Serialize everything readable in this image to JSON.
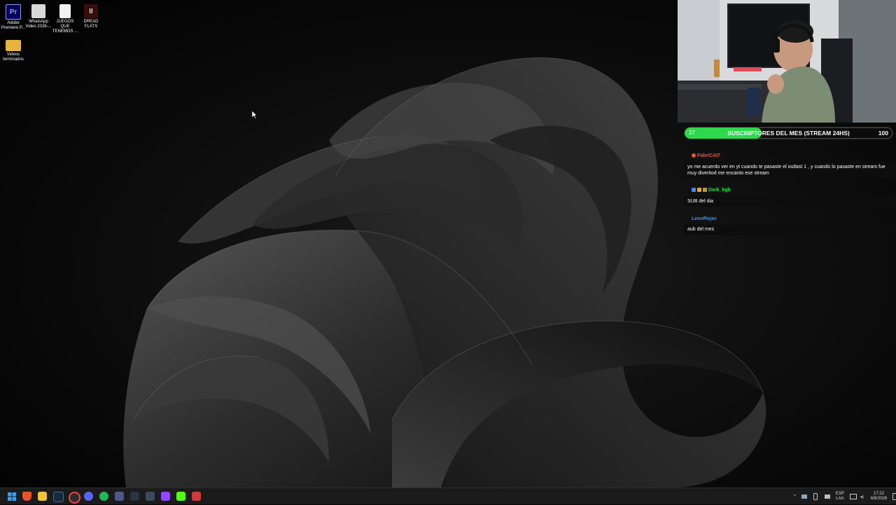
{
  "desktop": {
    "icons": [
      {
        "label": "Adobe Premiere P...",
        "glyph": "Pr"
      },
      {
        "label": "WhatsApp Video 2026-...",
        "glyph": ""
      },
      {
        "label": "JUEGOS QUE TENEMOS ...",
        "glyph": ""
      },
      {
        "label": "DREAD FLATS",
        "glyph": "II"
      },
      {
        "label": "Videos terminados",
        "glyph": ""
      }
    ]
  },
  "goal": {
    "current": "37",
    "title": "SUSCRIPTORES DEL MES (STREAM 24HS)",
    "target": "100",
    "progress": 0.37,
    "color": "#2bd94a"
  },
  "chat": [
    {
      "user": "FabriCAI7",
      "color": "#e0554f",
      "text": "yo me acuerdo ver en yt cuando te pasaste el outlast 1 , y cuando lo pasaste en stream fue muy diveritod me encanto ese stream"
    },
    {
      "user": "Dark_kgb",
      "color": "#2bd94a",
      "text": "SUB del dia"
    },
    {
      "user": "LeooRojas",
      "color": "#3a8ef0",
      "text": "aub del mes"
    }
  ],
  "taskbar": {
    "apps": [
      "windows-start",
      "brave",
      "file-explorer",
      "steam",
      "chrome",
      "discord",
      "spotify",
      "display",
      "network",
      "vpn",
      "twitch",
      "kick",
      "video-editor"
    ],
    "tray": {
      "lang_top": "ESP",
      "lang_bottom": "LAA",
      "time": "17:22",
      "date": "6/8/2026"
    }
  }
}
